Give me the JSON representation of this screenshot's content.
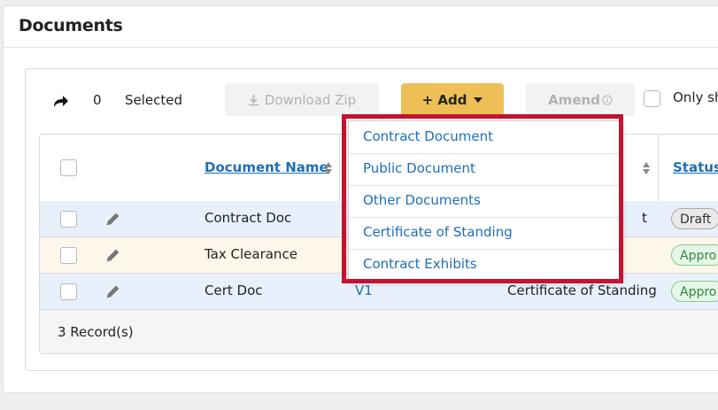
{
  "page": {
    "title": "Documents"
  },
  "toolbar": {
    "selected_count": "0",
    "selected_label": "Selected",
    "download_zip_label": "Download Zip",
    "add_label": "+ Add",
    "amend_label": "Amend",
    "only_label": "Only sh"
  },
  "table": {
    "headers": {
      "document_name": "Document Name",
      "status": "Status"
    },
    "rows": [
      {
        "name": "Contract Doc",
        "version": "",
        "type_partial": "t",
        "status": "Draft"
      },
      {
        "name": "Tax Clearance",
        "version": "",
        "type_partial": "",
        "status": "Appro"
      },
      {
        "name": "Cert Doc",
        "version": "V1",
        "type_partial": "Certificate of Standing",
        "status": "Appro"
      }
    ],
    "footer": "3 Record(s)"
  },
  "add_menu": {
    "items": [
      "Contract Document",
      "Public Document",
      "Other Documents",
      "Certificate of Standing",
      "Contract Exhibits"
    ]
  },
  "colors": {
    "accent": "#eebf57",
    "link": "#1f6fb4",
    "highlight": "#c41230"
  }
}
